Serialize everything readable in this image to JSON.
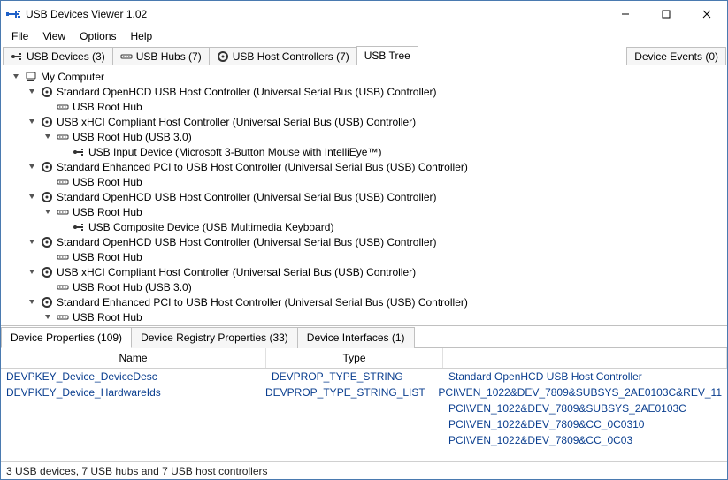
{
  "window": {
    "title": "USB Devices Viewer 1.02"
  },
  "menus": {
    "file": "File",
    "view": "View",
    "options": "Options",
    "help": "Help"
  },
  "tabs": {
    "devices": "USB Devices (3)",
    "hubs": "USB Hubs (7)",
    "controllers": "USB Host Controllers (7)",
    "tree": "USB Tree",
    "events": "Device Events (0)"
  },
  "tree": [
    {
      "depth": 0,
      "exp": true,
      "icon": "computer",
      "label": "My Computer"
    },
    {
      "depth": 1,
      "exp": true,
      "icon": "gear",
      "label": "Standard OpenHCD USB Host Controller (Universal Serial Bus (USB) Controller)"
    },
    {
      "depth": 2,
      "exp": false,
      "icon": "hub",
      "label": "USB Root Hub"
    },
    {
      "depth": 1,
      "exp": true,
      "icon": "gear",
      "label": "USB xHCI Compliant Host Controller (Universal Serial Bus (USB) Controller)"
    },
    {
      "depth": 2,
      "exp": true,
      "icon": "hub",
      "label": "USB Root Hub (USB 3.0)"
    },
    {
      "depth": 3,
      "exp": false,
      "icon": "usb",
      "label": "USB Input Device (Microsoft 3-Button Mouse with IntelliEye™)"
    },
    {
      "depth": 1,
      "exp": true,
      "icon": "gear",
      "label": "Standard Enhanced PCI to USB Host Controller (Universal Serial Bus (USB) Controller)"
    },
    {
      "depth": 2,
      "exp": false,
      "icon": "hub",
      "label": "USB Root Hub"
    },
    {
      "depth": 1,
      "exp": true,
      "icon": "gear",
      "label": "Standard OpenHCD USB Host Controller (Universal Serial Bus (USB) Controller)"
    },
    {
      "depth": 2,
      "exp": true,
      "icon": "hub",
      "label": "USB Root Hub"
    },
    {
      "depth": 3,
      "exp": false,
      "icon": "usb",
      "label": "USB Composite Device (USB Multimedia Keyboard)"
    },
    {
      "depth": 1,
      "exp": true,
      "icon": "gear",
      "label": "Standard OpenHCD USB Host Controller (Universal Serial Bus (USB) Controller)"
    },
    {
      "depth": 2,
      "exp": false,
      "icon": "hub",
      "label": "USB Root Hub"
    },
    {
      "depth": 1,
      "exp": true,
      "icon": "gear",
      "label": "USB xHCI Compliant Host Controller (Universal Serial Bus (USB) Controller)"
    },
    {
      "depth": 2,
      "exp": false,
      "icon": "hub",
      "label": "USB Root Hub (USB 3.0)"
    },
    {
      "depth": 1,
      "exp": true,
      "icon": "gear",
      "label": "Standard Enhanced PCI to USB Host Controller (Universal Serial Bus (USB) Controller)"
    },
    {
      "depth": 2,
      "exp": true,
      "icon": "hub",
      "label": "USB Root Hub"
    }
  ],
  "bottomTabs": {
    "props": "Device Properties (109)",
    "reg": "Device Registry Properties (33)",
    "ifaces": "Device Interfaces (1)"
  },
  "propHeaders": {
    "name": "Name",
    "type": "Type"
  },
  "propRows": [
    {
      "name": "DEVPKEY_Device_DeviceDesc",
      "type": "DEVPROP_TYPE_STRING",
      "value": "Standard OpenHCD USB Host Controller"
    },
    {
      "name": "DEVPKEY_Device_HardwareIds",
      "type": "DEVPROP_TYPE_STRING_LIST",
      "value": "PCI\\VEN_1022&DEV_7809&SUBSYS_2AE0103C&REV_11"
    },
    {
      "name": "",
      "type": "",
      "value": "PCI\\VEN_1022&DEV_7809&SUBSYS_2AE0103C"
    },
    {
      "name": "",
      "type": "",
      "value": "PCI\\VEN_1022&DEV_7809&CC_0C0310"
    },
    {
      "name": "",
      "type": "",
      "value": "PCI\\VEN_1022&DEV_7809&CC_0C03"
    }
  ],
  "status": "3 USB devices, 7 USB hubs and 7 USB host controllers"
}
